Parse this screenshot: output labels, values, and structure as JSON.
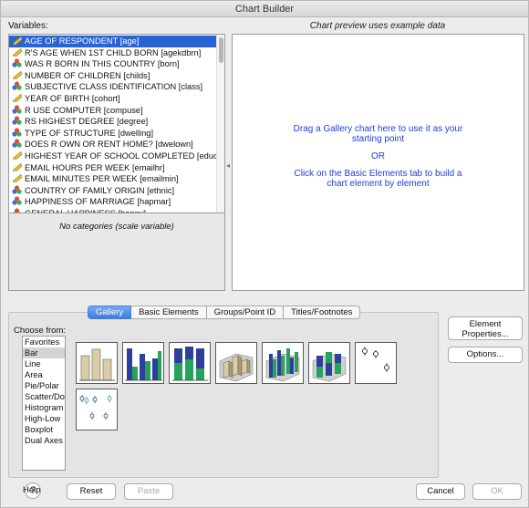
{
  "window": {
    "title": "Chart Builder"
  },
  "variables": {
    "label": "Variables:",
    "items": [
      {
        "label": "AGE OF RESPONDENT [age]",
        "icon": "ruler-icon",
        "selected": true
      },
      {
        "label": "R'S AGE WHEN 1ST CHILD BORN [agekdbrn]",
        "icon": "ruler-icon"
      },
      {
        "label": "WAS R BORN IN THIS COUNTRY [born]",
        "icon": "nominal-icon"
      },
      {
        "label": "NUMBER OF CHILDREN [childs]",
        "icon": "ruler-icon"
      },
      {
        "label": "SUBJECTIVE CLASS IDENTIFICATION [class]",
        "icon": "nominal-icon"
      },
      {
        "label": "YEAR OF BIRTH [cohort]",
        "icon": "ruler-icon"
      },
      {
        "label": "R USE COMPUTER [compuse]",
        "icon": "nominal-icon"
      },
      {
        "label": "RS HIGHEST DEGREE [degree]",
        "icon": "nominal-icon"
      },
      {
        "label": "TYPE OF STRUCTURE [dwelling]",
        "icon": "nominal-icon"
      },
      {
        "label": "DOES R OWN OR RENT HOME? [dwelown]",
        "icon": "nominal-icon"
      },
      {
        "label": "HIGHEST YEAR OF SCHOOL COMPLETED [educ]",
        "icon": "ruler-icon"
      },
      {
        "label": "EMAIL HOURS PER WEEK [emailhr]",
        "icon": "ruler-icon"
      },
      {
        "label": "EMAIL MINUTES PER WEEK [emailmin]",
        "icon": "ruler-icon"
      },
      {
        "label": "COUNTRY OF FAMILY ORIGIN  [ethnic]",
        "icon": "nominal-icon"
      },
      {
        "label": "HAPPINESS OF MARRIAGE [hapmar]",
        "icon": "nominal-icon"
      },
      {
        "label": "GENERAL HAPPINESS [happy]",
        "icon": "nominal-icon"
      }
    ]
  },
  "categories": {
    "label": "No categories (scale variable)"
  },
  "preview": {
    "label": "Chart preview uses example data",
    "line1": "Drag a Gallery chart here to use it as your",
    "line2": "starting point",
    "or": "OR",
    "line3": "Click on the Basic Elements tab to build a",
    "line4": "chart element by element"
  },
  "tabs": [
    {
      "label": "Gallery",
      "active": true
    },
    {
      "label": "Basic Elements"
    },
    {
      "label": "Groups/Point ID"
    },
    {
      "label": "Titles/Footnotes"
    }
  ],
  "gallery": {
    "choose_label": "Choose from:",
    "types": [
      "Favorites",
      "Bar",
      "Line",
      "Area",
      "Pie/Polar",
      "Scatter/Dot",
      "Histogram",
      "High-Low",
      "Boxplot",
      "Dual Axes"
    ],
    "selected": "Bar",
    "thumbnails": [
      {
        "name": "simple-bar",
        "colors": [
          "#d8ccaa",
          "#8c8660"
        ]
      },
      {
        "name": "clustered-bar",
        "colors": [
          "#2c3f9a",
          "#26a35a"
        ]
      },
      {
        "name": "stacked-bar",
        "colors": [
          "#2c3f9a",
          "#26a35a"
        ]
      },
      {
        "name": "simple-3d-bar",
        "colors": [
          "#d8ccaa"
        ]
      },
      {
        "name": "clustered-3d-bar",
        "colors": [
          "#2c3f9a",
          "#26a35a"
        ]
      },
      {
        "name": "stacked-3d-bar",
        "colors": [
          "#2c3f9a",
          "#26a35a"
        ]
      },
      {
        "name": "simple-error-bar",
        "colors": [
          "#222222"
        ]
      },
      {
        "name": "clustered-error-bar",
        "colors": [
          "#2c3f9a",
          "#26a35a"
        ]
      }
    ]
  },
  "buttons": {
    "element_properties_1": "Element",
    "element_properties_2": "Properties...",
    "options": "Options...",
    "help": "Help",
    "reset": "Reset",
    "paste": "Paste",
    "cancel": "Cancel",
    "ok": "OK"
  },
  "colors": {
    "selection": "#2a63d4",
    "preview_text": "#2040d8",
    "tab_active": "#3c7be0"
  }
}
